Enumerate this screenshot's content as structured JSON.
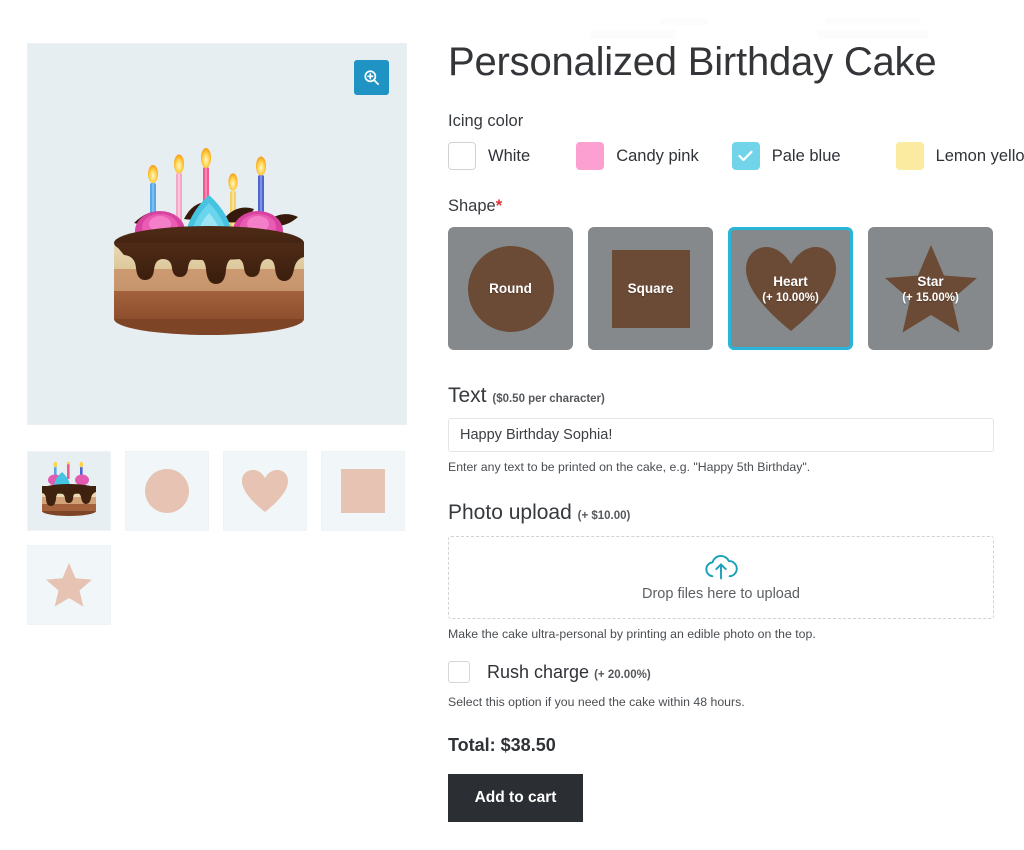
{
  "product": {
    "title": "Personalized Birthday Cake",
    "gallery": {
      "zoom_button_icon": "magnifier-plus-icon",
      "main_image_alt": "Chocolate layer birthday cake with five lit candles and pink and blue frosting rosettes",
      "thumbnails": [
        {
          "name": "cake-photo",
          "shape": "cake"
        },
        {
          "name": "round-shape",
          "shape": "circle"
        },
        {
          "name": "heart-shape",
          "shape": "heart"
        },
        {
          "name": "square-shape",
          "shape": "square"
        },
        {
          "name": "star-shape",
          "shape": "star"
        }
      ]
    }
  },
  "icing": {
    "label": "Icing color",
    "options": [
      {
        "label": "White",
        "color": "#ffffff",
        "checked": false
      },
      {
        "label": "Candy pink",
        "color": "#fba0d0",
        "checked": false
      },
      {
        "label": "Pale blue",
        "color": "#72d4e8",
        "checked": true
      },
      {
        "label": "Lemon yellow",
        "color": "#fbeba0",
        "checked": false
      }
    ]
  },
  "shape": {
    "label": "Shape",
    "required_marker": "*",
    "options": [
      {
        "name": "Round",
        "price": "",
        "shape": "circle",
        "selected": false
      },
      {
        "name": "Square",
        "price": "",
        "shape": "square",
        "selected": false
      },
      {
        "name": "Heart",
        "price": "(+ 10.00%)",
        "shape": "heart",
        "selected": true
      },
      {
        "name": "Star",
        "price": "(+ 15.00%)",
        "shape": "star",
        "selected": false
      }
    ]
  },
  "text_field": {
    "label": "Text",
    "price_suffix": "($0.50 per character)",
    "value": "Happy Birthday Sophia!",
    "placeholder": "",
    "helper": "Enter any text to be printed on the cake, e.g. \"Happy 5th Birthday\"."
  },
  "photo_upload": {
    "label": "Photo upload",
    "price_suffix": "(+ $10.00)",
    "dropzone_text": "Drop files here to upload",
    "dropzone_icon": "cloud-upload-icon",
    "helper": "Make the cake ultra-personal by printing an edible photo on the top."
  },
  "rush": {
    "label": "Rush charge",
    "price_suffix": "(+ 20.00%)",
    "checked": false,
    "helper": "Select this option if you need the cake within 48 hours."
  },
  "summary": {
    "total": "Total: $38.50",
    "add_to_cart": "Add to cart"
  },
  "colors": {
    "accent_blue": "#1f93c4",
    "selected_border": "#2ab4d8",
    "shape_card_bg": "#85898c",
    "shape_art": "#6b4b36",
    "button_dark": "#2b2f33",
    "stage_bg": "#e6eef2",
    "thumb_shape": "#e6c3b2"
  }
}
